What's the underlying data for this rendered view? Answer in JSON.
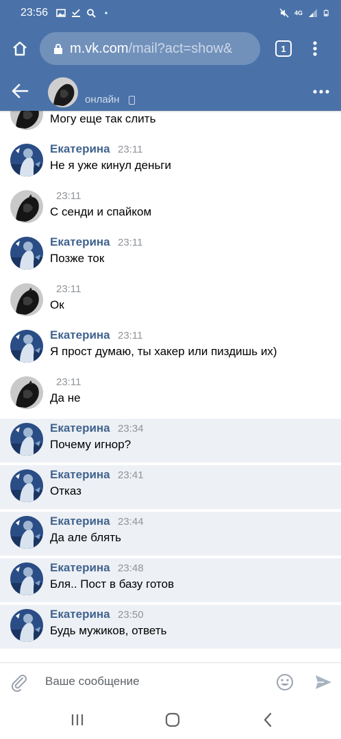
{
  "status_bar": {
    "time": "23:56",
    "network": "4G"
  },
  "browser": {
    "url_host": "m.vk.com",
    "url_path": "/mail?act=show&",
    "tab_count": "1"
  },
  "chat_header": {
    "status": "онлайн"
  },
  "messages": [
    {
      "name": "",
      "time": "",
      "text": "Могу еще так слить",
      "own": true,
      "unread": false
    },
    {
      "name": "Екатерина",
      "time": "23:11",
      "text": "Не я уже кинул деньги",
      "own": false,
      "unread": false
    },
    {
      "name": "",
      "time": "23:11",
      "text": "С сенди и спайком",
      "own": true,
      "unread": false
    },
    {
      "name": "Екатерина",
      "time": "23:11",
      "text": "Позже ток",
      "own": false,
      "unread": false
    },
    {
      "name": "",
      "time": "23:11",
      "text": "Ок",
      "own": true,
      "unread": false
    },
    {
      "name": "Екатерина",
      "time": "23:11",
      "text": "Я прост думаю, ты хакер или пиздишь их)",
      "own": false,
      "unread": false
    },
    {
      "name": "",
      "time": "23:11",
      "text": "Да не",
      "own": true,
      "unread": false
    },
    {
      "name": "Екатерина",
      "time": "23:34",
      "text": "Почему игнор?",
      "own": false,
      "unread": true
    },
    {
      "name": "Екатерина",
      "time": "23:41",
      "text": "Отказ",
      "own": false,
      "unread": true
    },
    {
      "name": "Екатерина",
      "time": "23:44",
      "text": "Да але блять",
      "own": false,
      "unread": true
    },
    {
      "name": "Екатерина",
      "time": "23:48",
      "text": "Бля.. Пост в базу готов",
      "own": false,
      "unread": true
    },
    {
      "name": "Екатерина",
      "time": "23:50",
      "text": "Будь мужиков, ответь",
      "own": false,
      "unread": true
    }
  ],
  "compose": {
    "placeholder": "Ваше сообщение"
  },
  "colors": {
    "brand": "#4a72a8",
    "name": "#41638e",
    "unread_bg": "#edf0f5"
  },
  "icons": [
    "gallery-icon",
    "download-done-icon",
    "search-icon",
    "mute-icon",
    "signal-icon",
    "battery-icon",
    "home-icon",
    "lock-icon",
    "tabs-icon",
    "menu-dots-icon",
    "back-arrow-icon",
    "phone-icon",
    "more-icon",
    "attach-icon",
    "emoji-icon",
    "send-icon",
    "recents-icon",
    "home-nav-icon",
    "back-nav-icon"
  ]
}
